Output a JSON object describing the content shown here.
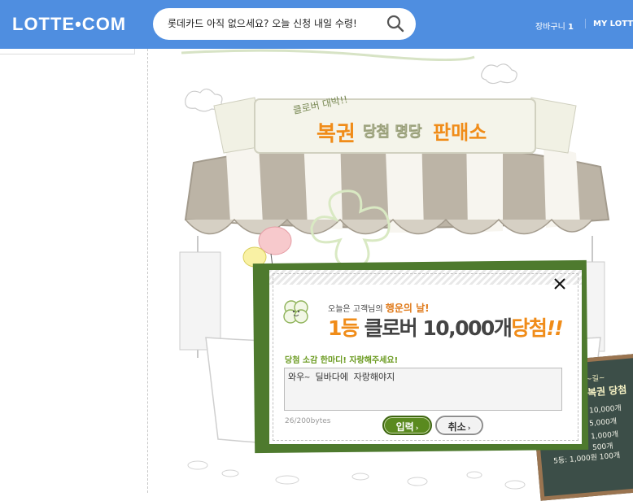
{
  "header": {
    "logo": "LOTTE•COM",
    "search_placeholder": "롯데카드 아직 없으세요? 오늘 신청 내일 수령!",
    "cart_label": "장바구니",
    "cart_count": "1",
    "my_lotte": "MY LOTTE"
  },
  "scene": {
    "awning_tag": "클로버 대박!!",
    "sign_title_1": "복권",
    "sign_title_2": "당첨 명당",
    "sign_title_3": "판매소"
  },
  "popup": {
    "line1_prefix": "오늘은 고객님의",
    "line1_highlight": "행운의 날!",
    "rank": "1등",
    "prize_a": "클로버",
    "prize_b": "10,000개",
    "win": "당첨",
    "bang": "!!",
    "comment_label": "당첨 소감 한마디! 자랑해주세요!",
    "comment_value": "와우~ 딜바다에 자랑해야지",
    "counter": "26/200bytes",
    "ok_label": "입력",
    "cancel_label": "취소"
  },
  "chalkboard": {
    "top": "~길~",
    "title": "복권 당첨",
    "lines": [
      "10,000개",
      "5,000개",
      "1,000개",
      "500개",
      "5등: 1,000원 100개"
    ]
  },
  "colors": {
    "header_bg": "#4f8ee0",
    "popup_border": "#4e7a2e",
    "accent_orange": "#f08c19",
    "accent_green": "#6a9a1f"
  }
}
